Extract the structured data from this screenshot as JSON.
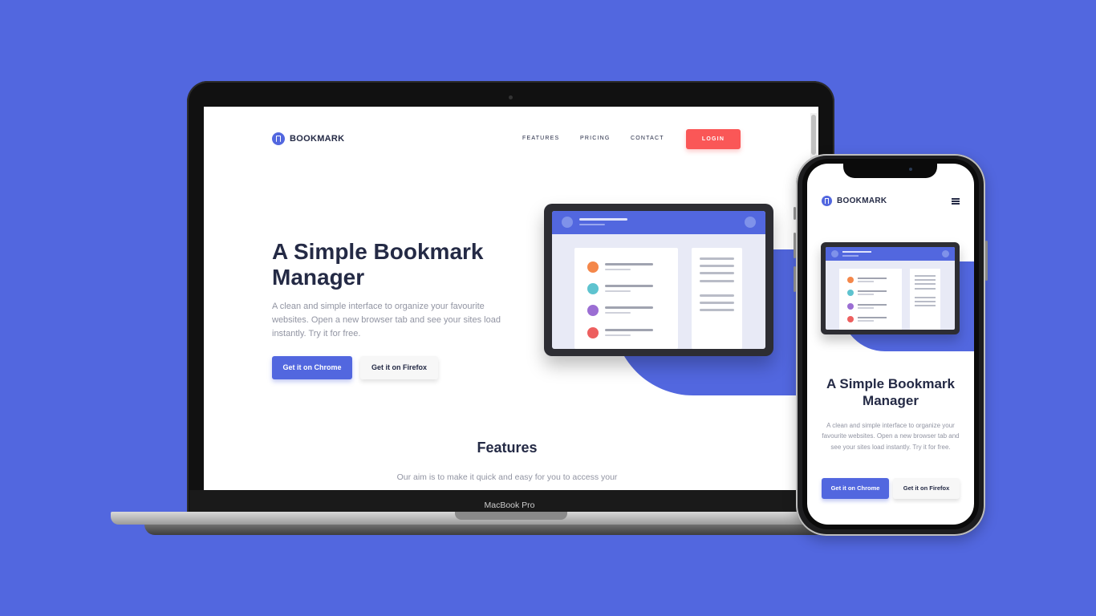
{
  "colors": {
    "background": "#5267df",
    "accent": "#5267df",
    "login": "#fa5757",
    "text_dark": "#242a45",
    "text_muted": "#9194a2"
  },
  "laptop": {
    "brand_label": "MacBook Pro",
    "site": {
      "logo_text": "BOOKMARK",
      "nav": {
        "features": "FEATURES",
        "pricing": "PRICING",
        "contact": "CONTACT",
        "login": "LOGIN"
      },
      "hero": {
        "title": "A Simple Bookmark Manager",
        "description": "A clean and simple interface to organize your favourite websites. Open a new browser tab and see your sites load instantly. Try it for free.",
        "chrome_button": "Get it on Chrome",
        "firefox_button": "Get it on Firefox"
      },
      "features": {
        "title": "Features",
        "description": "Our aim is to make it quick and easy for you to access your"
      }
    }
  },
  "phone": {
    "site": {
      "logo_text": "BOOKMARK",
      "menu_icon": "hamburger-icon",
      "hero": {
        "title": "A Simple Bookmark Manager",
        "description": "A clean and simple interface to organize your favourite websites. Open a new browser tab and see your sites load instantly. Try it for free.",
        "chrome_button": "Get it on Chrome",
        "firefox_button": "Get it on Firefox"
      }
    }
  },
  "illustration": {
    "dot_colors": [
      "#f4874a",
      "#5ec3cf",
      "#9b6ed3",
      "#ed5f5f"
    ]
  }
}
